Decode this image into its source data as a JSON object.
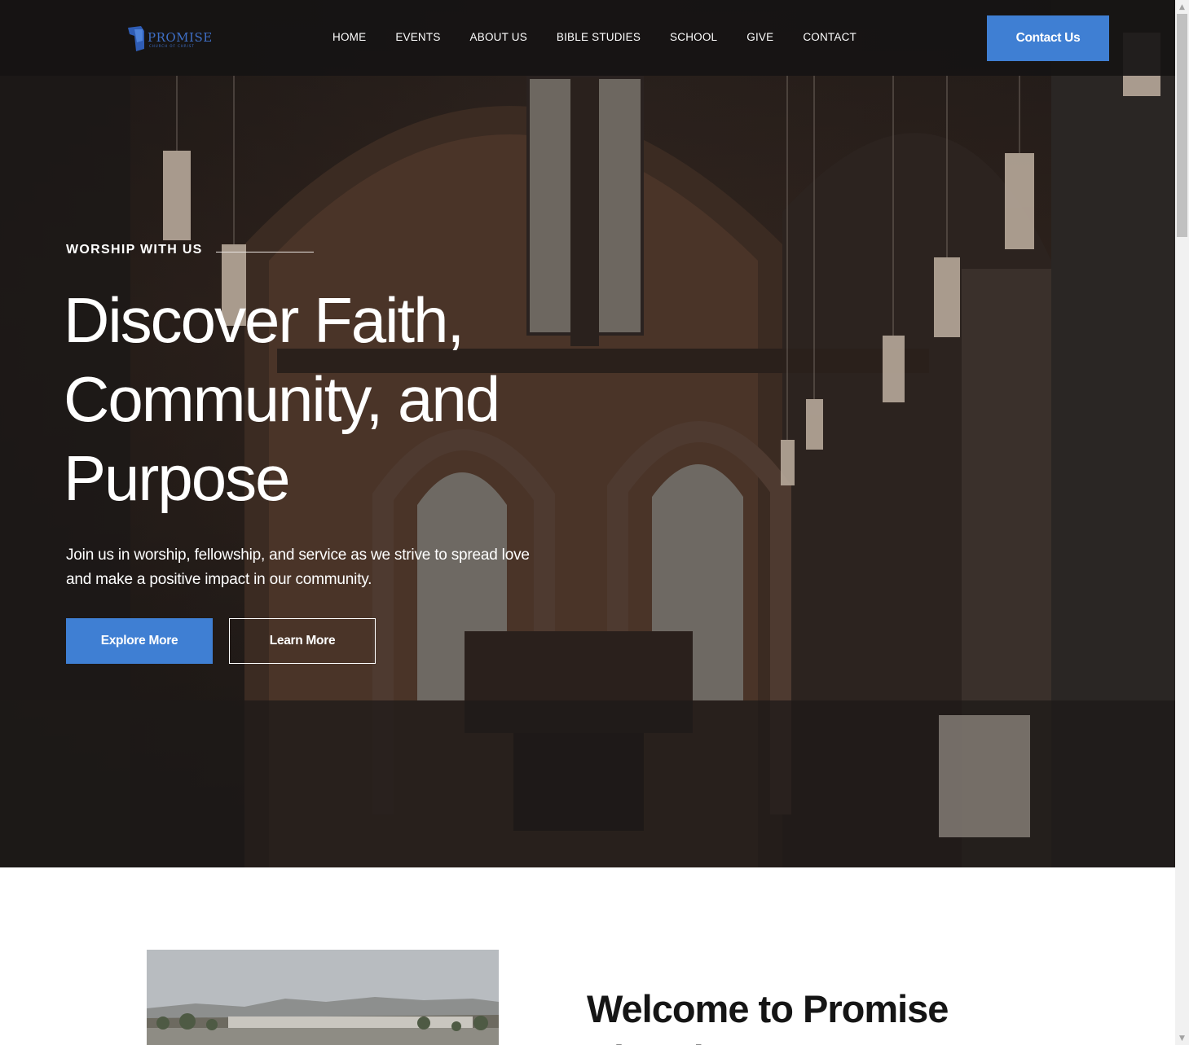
{
  "header": {
    "logo_text": "PROMISE",
    "logo_subtext": "CHURCH OF CHRIST",
    "nav_items": [
      "HOME",
      "EVENTS",
      "ABOUT US",
      "BIBLE STUDIES",
      "SCHOOL",
      "GIVE",
      "CONTACT"
    ],
    "cta_label": "Contact Us"
  },
  "hero": {
    "eyebrow": "WORSHIP WITH US",
    "headline_line1": "Discover Faith,",
    "headline_line2": "Community, and",
    "headline_line3": "Purpose",
    "lead_line1": "Join us in worship, fellowship, and service as we strive to spread love",
    "lead_line2": "and make a positive impact in our community.",
    "primary_button": "Explore More",
    "secondary_button": "Learn More"
  },
  "welcome": {
    "title_line1": "Welcome to Promise",
    "title_line2": "Church"
  },
  "colors": {
    "accent": "#3f7fd3",
    "nav_background": "#161414",
    "hero_tone": "#3a2a22",
    "heading_dark": "#151515"
  },
  "icons": [
    "logo-mark-icon",
    "scroll-up-arrow-icon",
    "scroll-down-arrow-icon"
  ]
}
